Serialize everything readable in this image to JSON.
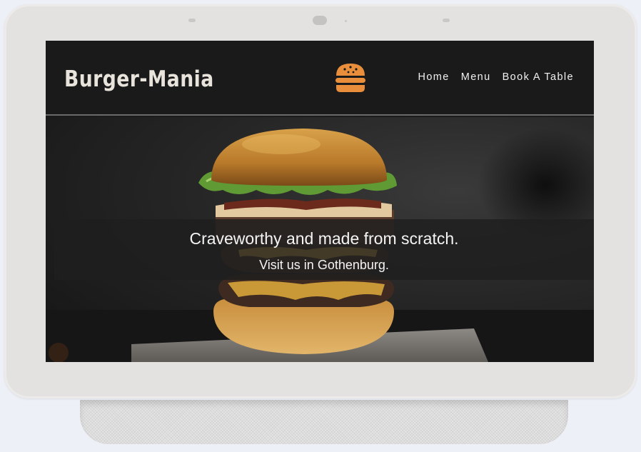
{
  "header": {
    "brand": "Burger-Mania",
    "logo_icon": "burger-icon",
    "nav": [
      {
        "label": "Home"
      },
      {
        "label": "Menu"
      },
      {
        "label": "Book A Table"
      }
    ]
  },
  "hero": {
    "image": "burger-photo",
    "title": "Craveworthy and made from scratch.",
    "subtitle": "Visit us in Gothenburg."
  },
  "colors": {
    "accent": "#e98f3c",
    "header_bg": "#1a1a1a",
    "device_frame": "#e3e2e0"
  }
}
